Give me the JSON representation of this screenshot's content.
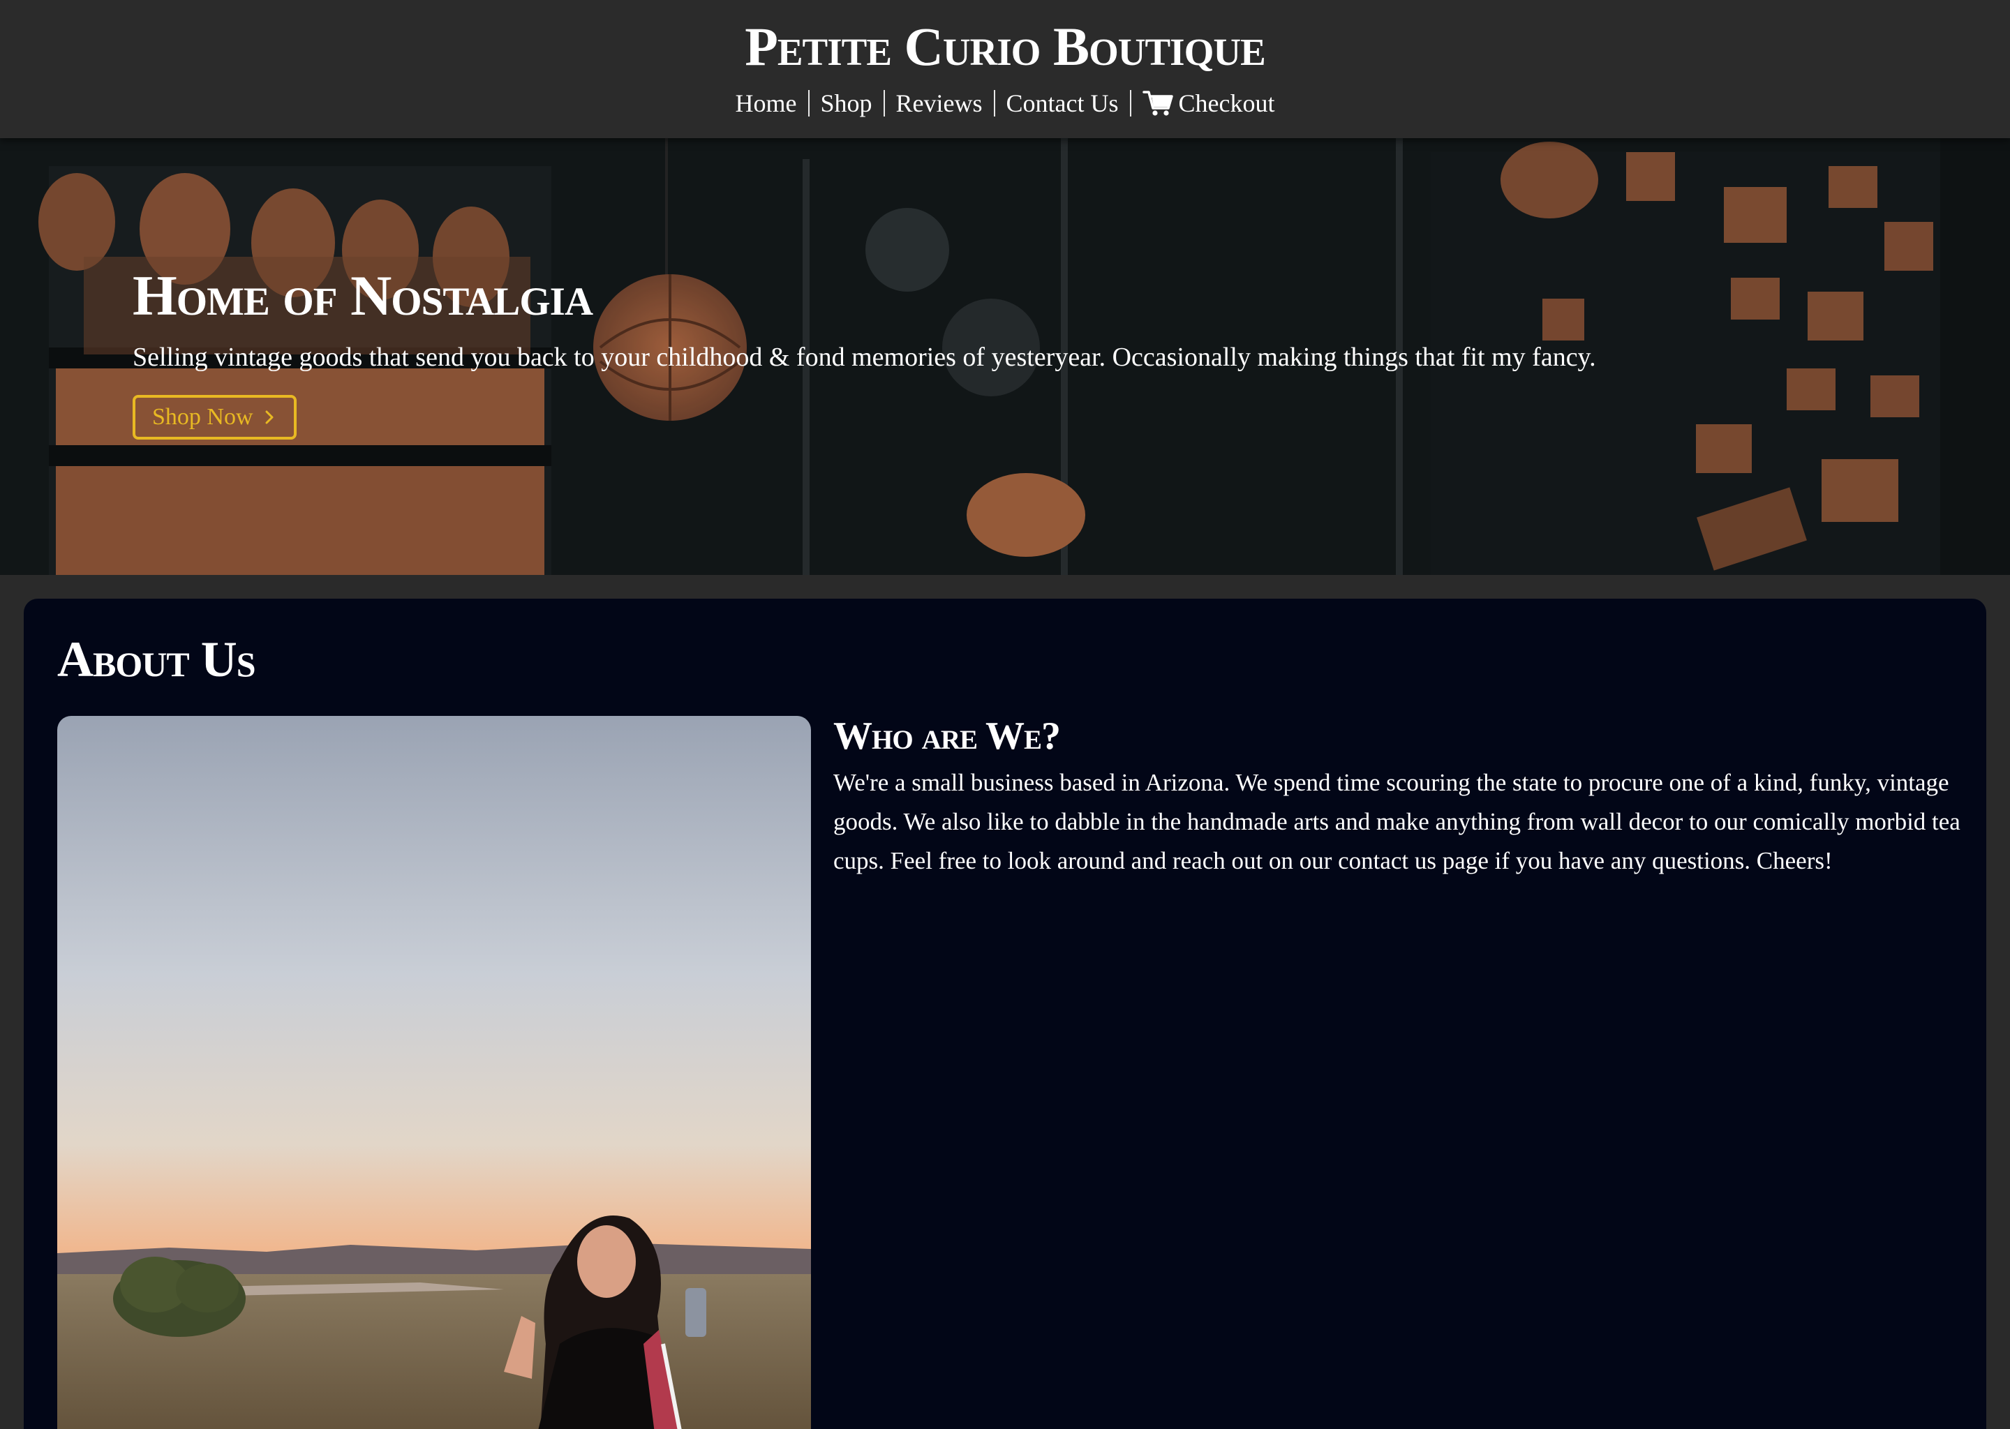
{
  "header": {
    "brand": "Petite Curio Boutique",
    "nav": [
      {
        "label": "Home"
      },
      {
        "label": "Shop"
      },
      {
        "label": "Reviews"
      },
      {
        "label": "Contact Us"
      },
      {
        "label": "Checkout",
        "icon": "cart-icon"
      }
    ]
  },
  "hero": {
    "title": "Home of Nostalgia",
    "subtitle": "Selling vintage goods that send you back to your childhood & fond memories of yesteryear. Occasionally making things that fit my fancy.",
    "button_label": "Shop Now",
    "button_icon": "chevron-right-icon",
    "accent_color": "#e8b923"
  },
  "about": {
    "title": "About Us",
    "who_title": "Who are We?",
    "who_text": "We're a small business based in Arizona. We spend time scouring the state to procure one of a kind, funky, vintage goods. We also like to dabble in the handmade arts and make anything from wall decor to our comically morbid tea cups. Feel free to look around and reach out on our contact us page if you have any questions. Cheers!",
    "background_color": "#020617"
  }
}
